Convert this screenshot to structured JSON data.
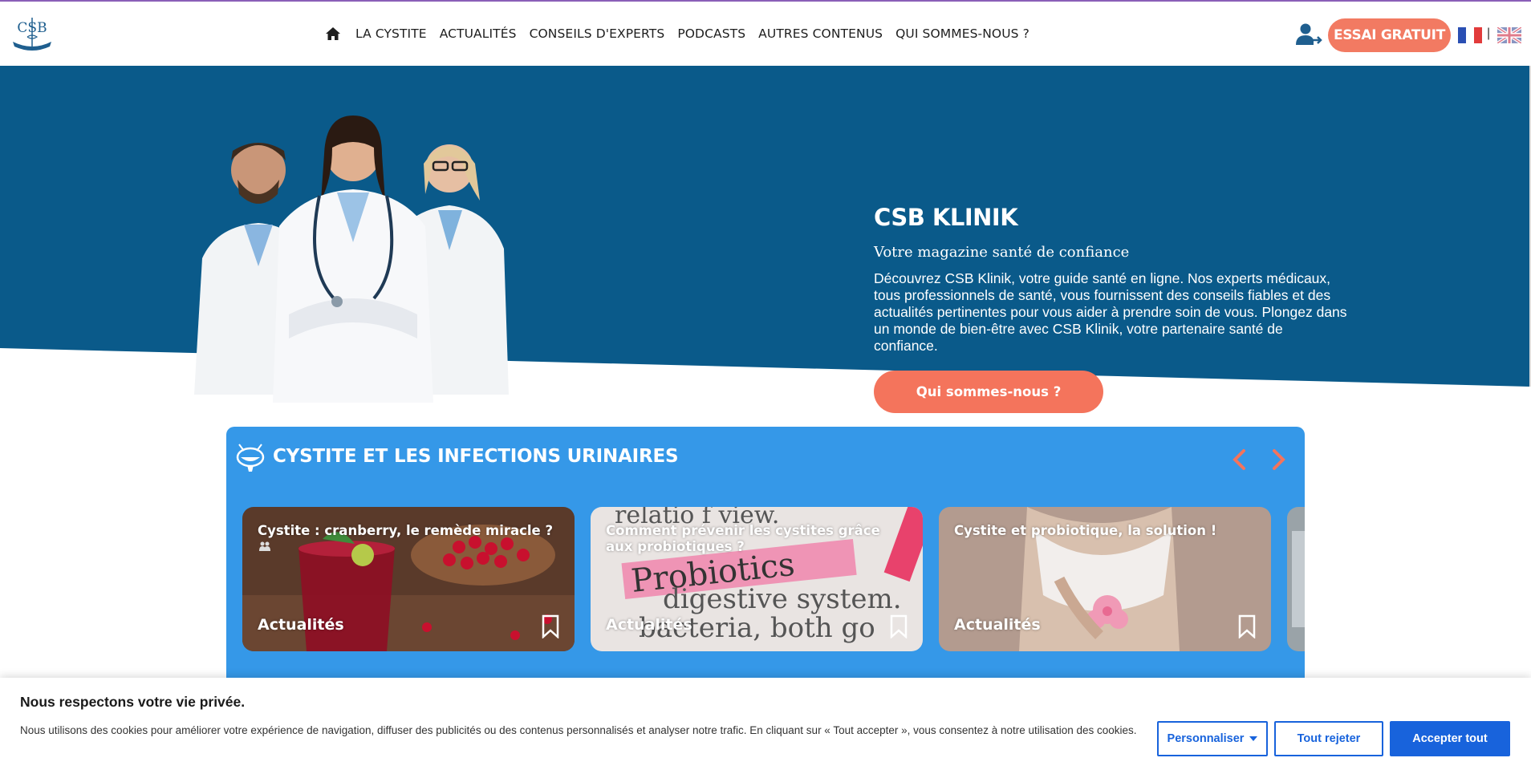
{
  "nav": {
    "items": [
      "LA CYSTITE",
      "ACTUALITÉS",
      "CONSEILS D'EXPERTS",
      "PODCASTS",
      "AUTRES CONTENUS",
      "QUI SOMMES-NOUS ?"
    ],
    "trial_label": "ESSAI GRATUIT",
    "flag_separator": "|",
    "logo_text": "CSB"
  },
  "hero": {
    "title": "CSB KLINIK",
    "subtitle": "Votre magazine santé de confiance",
    "text": "Découvrez CSB Klinik, votre guide santé en ligne. Nos experts médicaux, tous professionnels de santé, vous fournissent des conseils fiables et des actualités pertinentes pour vous aider à prendre soin de vous. Plongez dans un monde de bien-être avec CSB Klinik, votre partenaire santé de confiance.",
    "button_label": "Qui sommes-nous ?"
  },
  "section": {
    "title": "CYSTITE ET LES INFECTIONS URINAIRES",
    "cards": [
      {
        "title": "Cystite : cranberry, le remède miracle ?",
        "category": "Actualités"
      },
      {
        "title": "Comment prévenir les cystites grâce aux probiotiques ?",
        "category": "Actualités"
      },
      {
        "title": "Cystite et probiotique, la solution !",
        "category": "Actualités"
      }
    ]
  },
  "cookie": {
    "title": "Nous respectons votre vie privée.",
    "text": "Nous utilisons des cookies pour améliorer votre expérience de navigation, diffuser des publicités ou des contenus personnalisés et analyser notre trafic. En cliquant sur « Tout accepter », vous consentez à notre utilisation des cookies.",
    "customize_label": "Personnaliser",
    "reject_label": "Tout rejeter",
    "accept_label": "Accepter tout"
  },
  "colors": {
    "hero_bg": "#0a5a8a",
    "section_bg": "#3598e8",
    "accent": "#f27a62",
    "cookie_blue": "#1863dc"
  }
}
